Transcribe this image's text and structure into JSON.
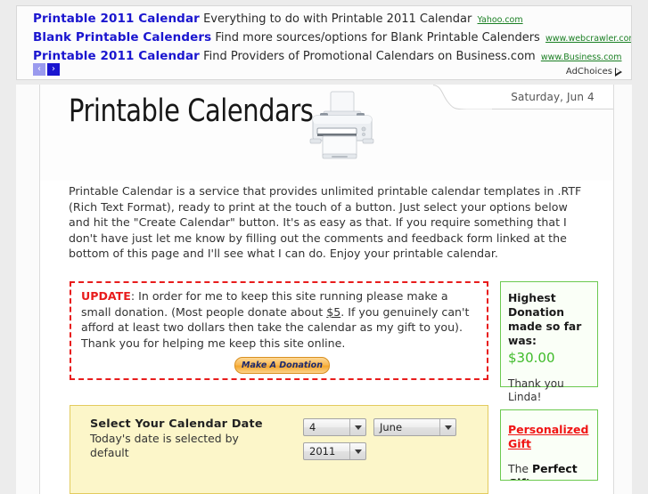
{
  "ads": {
    "rows": [
      {
        "title": "Printable 2011 Calendar",
        "desc": "Everything to do with Printable 2011 Calendar",
        "url": "Yahoo.com"
      },
      {
        "title": "Blank Printable Calenders",
        "desc": "Find more sources/options for Blank Printable Calenders",
        "url": "www.webcrawler.com"
      },
      {
        "title": "Printable 2011 Calendar",
        "desc": "Find Providers of Promotional Calendars on Business.com",
        "url": "www.Business.com"
      }
    ],
    "prev_arrow": "‹",
    "next_arrow": "›",
    "adchoices_label": "AdChoices"
  },
  "header": {
    "site_title": "Printable Calendars",
    "todays_date": "Saturday, Jun 4"
  },
  "intro": {
    "paragraph": "Printable Calendar is a service that provides unlimited printable calendar templates in .RTF (Rich Text Format), ready to print at the touch of a button. Just select your options below and hit the \"Create Calendar\" button. It's as easy as that. If you require something that I don't have just let me know by filling out the comments and feedback form linked at the bottom of this page and I'll see what I can do. Enjoy your printable calendar."
  },
  "update": {
    "label": "UPDATE",
    "text_before_amount": ": In order for me to keep this site running please make a small donation. (Most people donate about ",
    "amount": "$5",
    "text_after_amount": ". If you genuinely can't afford at least two dollars then take the calendar as my gift to you). Thank you for helping me keep this site online.",
    "donate_button_label": "Make A Donation"
  },
  "form": {
    "heading": "Select Your Calendar Date",
    "subtext": "Today's date is selected by default",
    "day_value": "4",
    "month_value": "June",
    "year_value": "2011"
  },
  "sidebar": {
    "donation": {
      "heading": "Highest Donation made so far was:",
      "amount": "$30.00",
      "thanks": "Thank you Linda!"
    },
    "gift": {
      "link": "Personalized Gift",
      "desc_prefix": "The ",
      "desc_bold": "Perfect Gift"
    }
  },
  "colors": {
    "ad_link": "#1a15cf",
    "ad_url": "#1a7f23",
    "update_red": "#e81c1c",
    "donation_green": "#3fbb2a",
    "card_border_green": "#6bc94f",
    "gift_link_red": "#f01414",
    "form_yellow": "#fcf6c9"
  }
}
